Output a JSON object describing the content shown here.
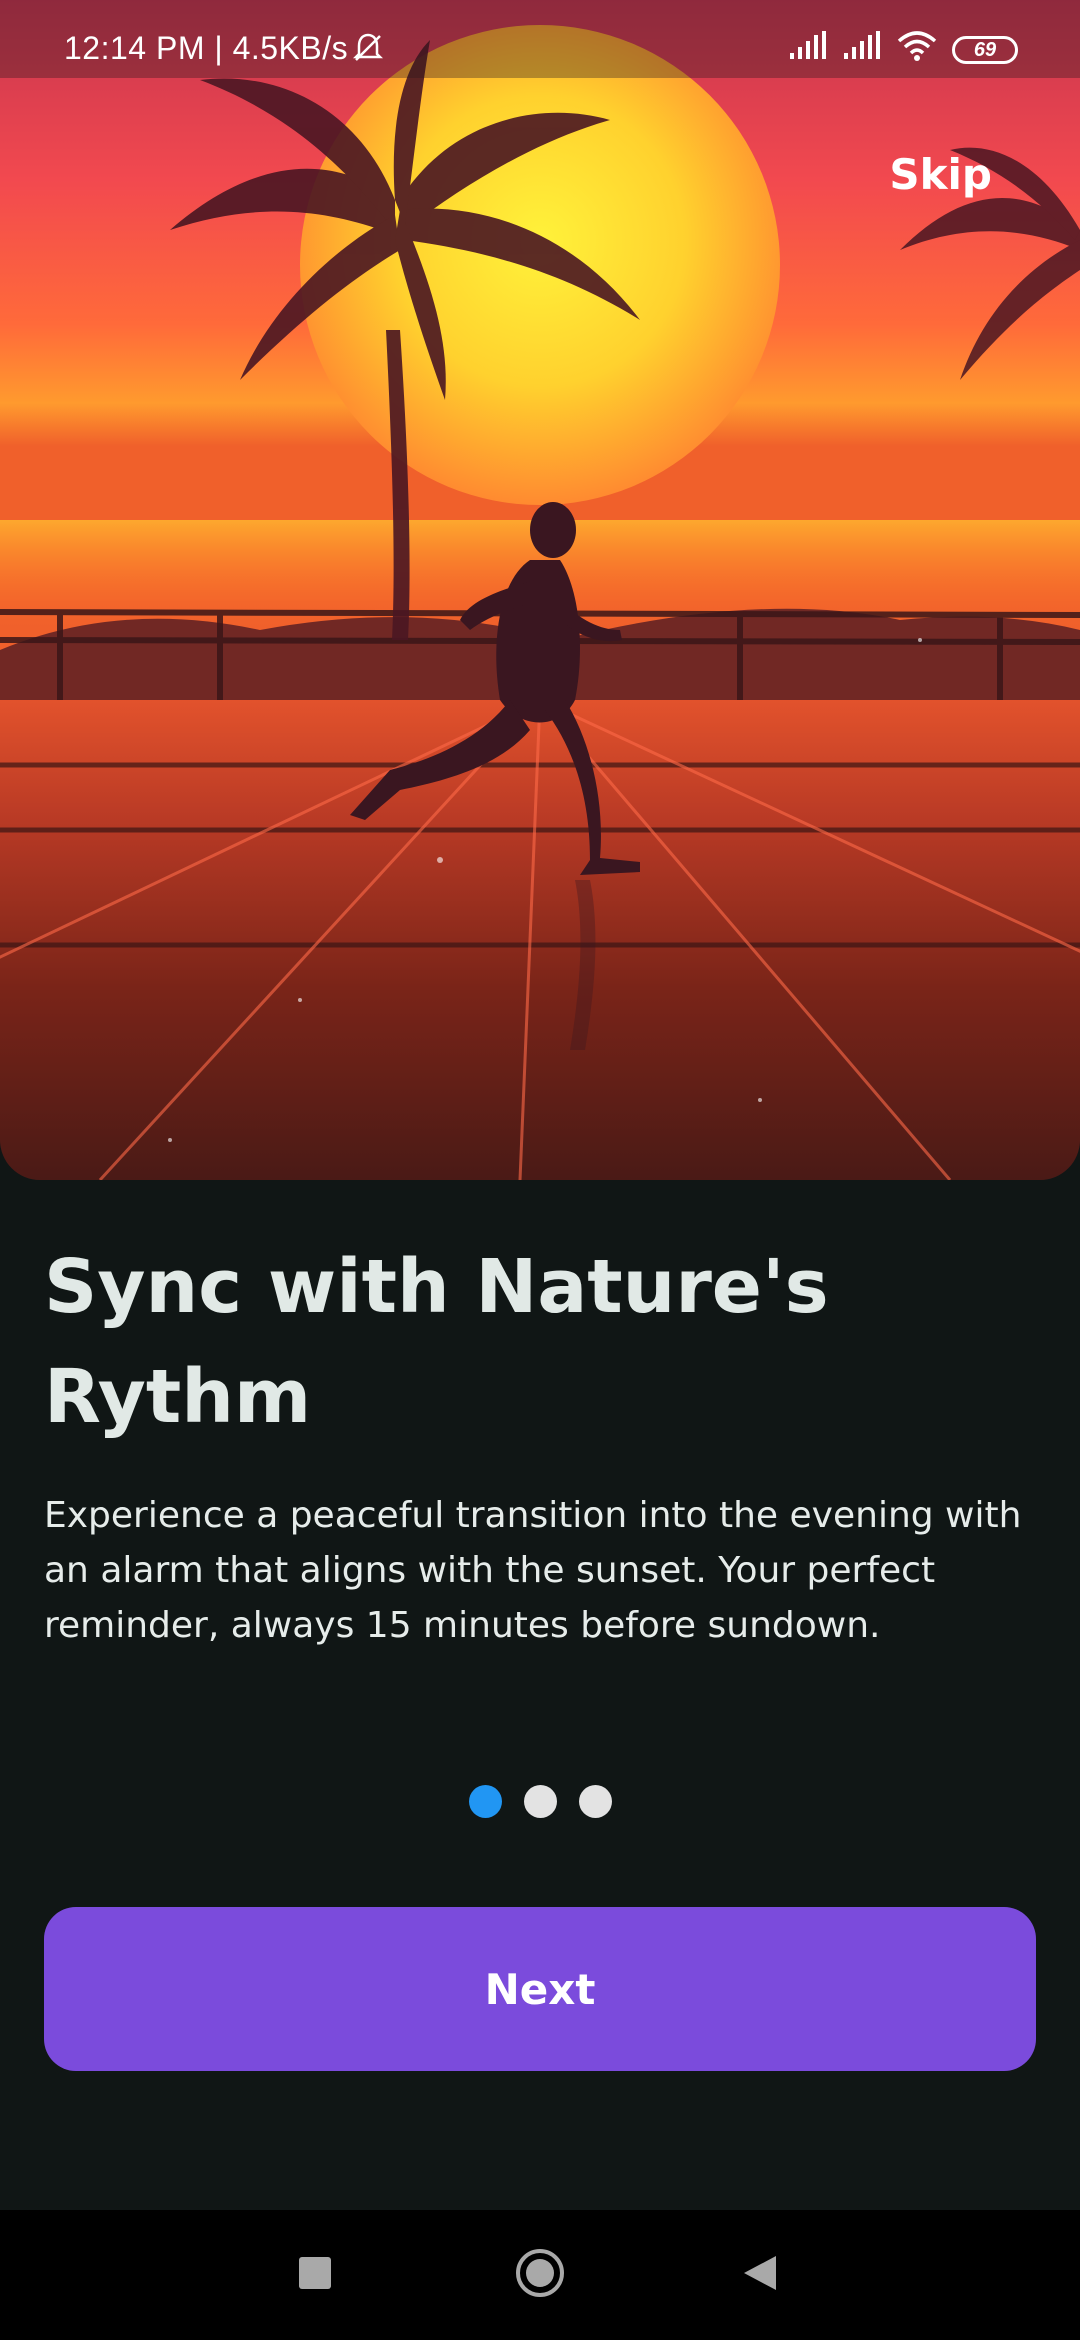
{
  "status_bar": {
    "time_speed": "12:14 PM | 4.5KB/s",
    "battery": "69",
    "icons": [
      "bell-off-icon",
      "signal-icon",
      "signal-icon",
      "wifi-icon",
      "battery-icon"
    ]
  },
  "onboarding": {
    "skip_label": "Skip",
    "title": "Sync with Nature's Rythm",
    "description": "Experience a peaceful transition into the evening with an alarm that aligns with the sunset. Your perfect reminder, always 15 minutes before sundown.",
    "page_count": 3,
    "active_page": 1,
    "next_label": "Next"
  },
  "nav": {
    "icons": [
      "recents-icon",
      "home-icon",
      "back-icon"
    ]
  },
  "colors": {
    "background": "#101615",
    "accent": "#7b4bdc",
    "indicator_active": "#2196f3",
    "indicator_inactive": "#e3e3e3",
    "title_text": "#e1e9e6"
  }
}
